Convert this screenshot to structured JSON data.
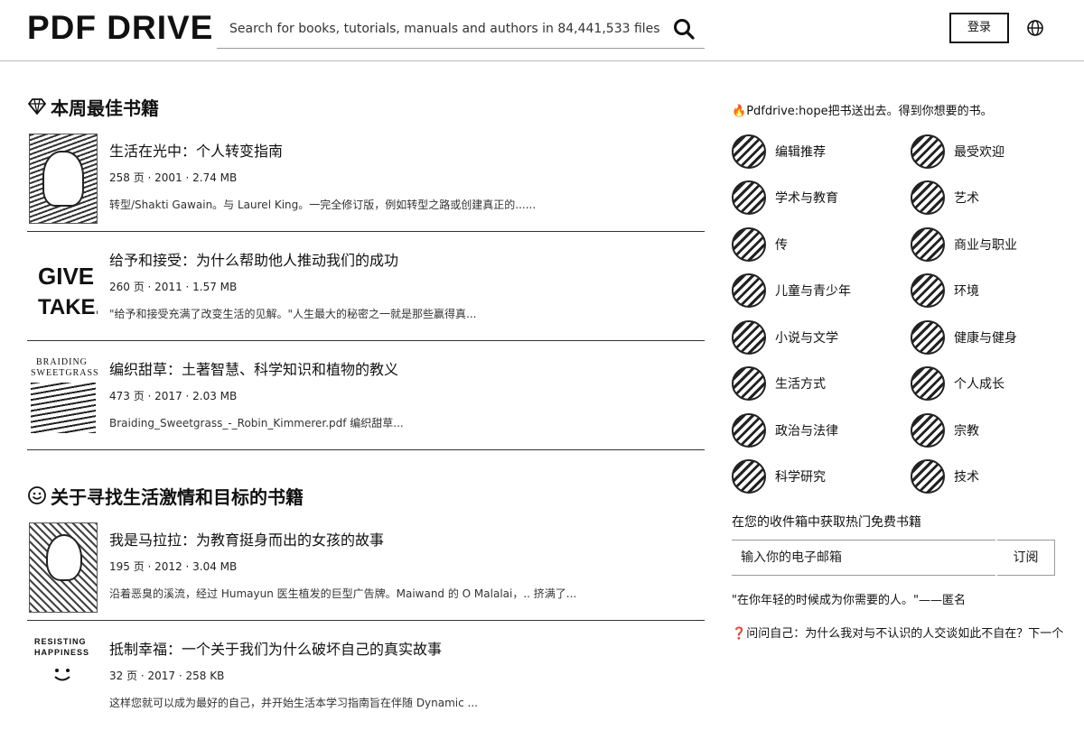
{
  "header": {
    "logo": "PDF DRIVE",
    "search_placeholder": "Search for books, tutorials, manuals and authors in 84,441,533 files",
    "login_label": "登录"
  },
  "sections": [
    {
      "title": "本周最佳书籍",
      "icon": "diamond-icon",
      "books": [
        {
          "title": "生活在光中：个人转变指南",
          "meta": "258 页 · 2001 · 2.74 MB",
          "desc": "转型/Shakti Gawain。与 Laurel King。一完全修订版，例如转型之路或创建真正的......"
        },
        {
          "title": "给予和接受：为什么帮助他人推动我们的成功",
          "meta": "260 页 · 2011 · 1.57 MB",
          "desc": "\"给予和接受充满了改变生活的见解。\"人生最大的秘密之一就是那些赢得真..."
        },
        {
          "title": "编织甜草：土著智慧、科学知识和植物的教义",
          "meta": "473 页 · 2017 · 2.03 MB",
          "desc": "Braiding_Sweetgrass_-_Robin_Kimmerer.pdf 编织甜草..."
        }
      ]
    },
    {
      "title": "关于寻找生活激情和目标的书籍",
      "icon": "smiley-icon",
      "books": [
        {
          "title": "我是马拉拉：为教育挺身而出的女孩的故事",
          "meta": "195 页 · 2012 · 3.04 MB",
          "desc": "沿着恶臭的溪流，经过 Humayun 医生植发的巨型广告牌。Maiwand 的 O Malalai，.. 挤满了..."
        },
        {
          "title": "抵制幸福：一个关于我们为什么破坏自己的真实故事",
          "meta": "32 页 · 2017 · 258 KB",
          "desc": "这样您就可以成为最好的自己，并开始生活本学习指南旨在伴随 Dynamic ..."
        }
      ]
    }
  ],
  "covers": {
    "c2_line1": "GIVE",
    "c2_line2": "TAKE.",
    "c3_line1": "BRAIDING",
    "c3_line2": "SWEETGRASS",
    "c5_line1": "RESISTING",
    "c5_line2": "HAPPINESS"
  },
  "sidebar": {
    "promo": "Pdfdrive:hope把书送出去。得到你想要的书。",
    "categories": [
      "编辑推荐",
      "最受欢迎",
      "学术与教育",
      "艺术",
      "传",
      "商业与职业",
      "儿童与青少年",
      "环境",
      "小说与文学",
      "健康与健身",
      "生活方式",
      "个人成长",
      "政治与法律",
      "宗教",
      "科学研究",
      "技术"
    ],
    "inbox_text": "在您的收件箱中获取热门免费书籍",
    "email_placeholder": "输入你的电子邮箱",
    "subscribe_label": "订阅",
    "quote": "\"在你年轻的时候成为你需要的人。\"——匿名",
    "ask": "问问自己：为什么我对与不认识的人交谈如此不自在？下一个"
  }
}
